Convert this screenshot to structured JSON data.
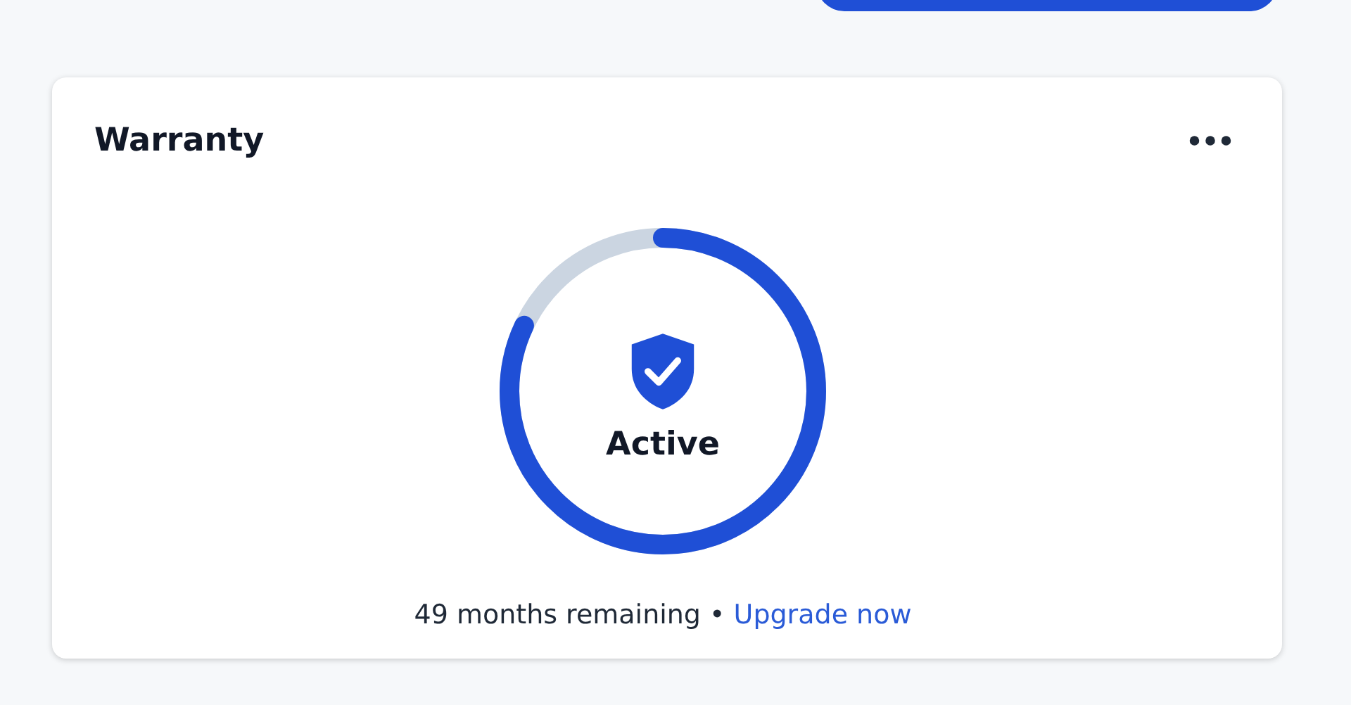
{
  "warranty_card": {
    "title": "Warranty",
    "status": "Active",
    "remaining": "49 months remaining",
    "separator": "•",
    "link": "Upgrade now"
  }
}
